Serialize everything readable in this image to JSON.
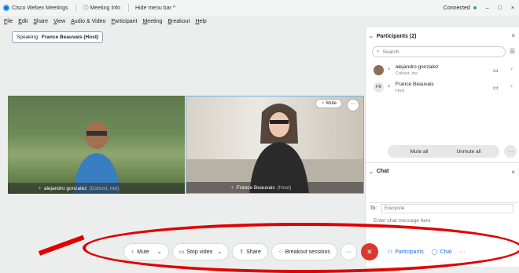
{
  "titlebar": {
    "app": "Cisco Webex Meetings",
    "meeting_info": "Meeting Info",
    "hide_menu": "Hide menu bar",
    "connected": "Connected",
    "minimize": "–",
    "maximize": "□",
    "close": "×"
  },
  "menu": [
    "File",
    "Edit",
    "Share",
    "View",
    "Audio & Video",
    "Participant",
    "Meeting",
    "Breakout",
    "Help"
  ],
  "speaking": {
    "label": "Speaking:",
    "name": "France Beauvais (Host)"
  },
  "videos": [
    {
      "name": "alejandro gonzalez",
      "sub": "(Cohost, me)"
    },
    {
      "name": "France Beauvais",
      "sub": "(Host)",
      "mute_label": "Mute",
      "more": "···"
    }
  ],
  "participants": {
    "title": "Participants (2)",
    "search_placeholder": "Search",
    "rows": [
      {
        "name": "alejandro gonzalez",
        "role": "Cohost, me",
        "initials": ""
      },
      {
        "name": "France Beauvais",
        "role": "Host",
        "initials": "FB"
      }
    ],
    "mute_all": "Mute all",
    "unmute_all": "Unmute all",
    "more": "···"
  },
  "chat": {
    "title": "Chat",
    "to_label": "To:",
    "to_value": "Everyone",
    "placeholder": "Enter chat message here"
  },
  "controls": {
    "mute": "Mute",
    "stop_video": "Stop video",
    "share": "Share",
    "breakout": "Breakout sessions",
    "more": "···",
    "participants": "Participants",
    "chat": "Chat",
    "more2": "···"
  },
  "colors": {
    "accent": "#1f6fd1",
    "end_call": "#e0342f",
    "annotation": "#e00000",
    "connected": "#2fb34a"
  }
}
